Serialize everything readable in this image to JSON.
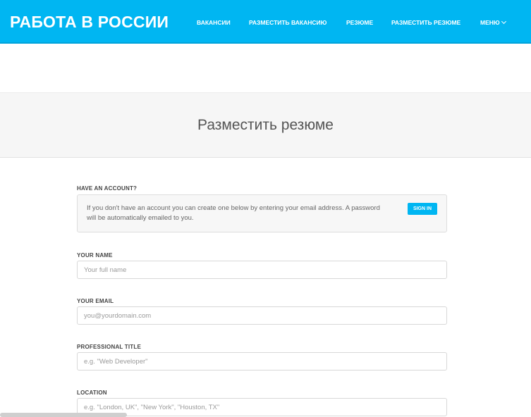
{
  "header": {
    "brand": "РАБОТА В РОССИИ",
    "nav": [
      {
        "label": "ВАКАНСИИ"
      },
      {
        "label": "РАЗМЕСТИТЬ ВАКАНСИЮ"
      },
      {
        "label": "РЕЗЮМЕ"
      },
      {
        "label": "РАЗМЕСТИТЬ РЕЗЮМЕ"
      },
      {
        "label": "МЕНЮ"
      }
    ],
    "accent_color": "#00b6f2"
  },
  "page": {
    "title": "Разместить резюме"
  },
  "form": {
    "account": {
      "label": "HAVE AN ACCOUNT?",
      "text": "If you don't have an account you can create one below by entering your email address. A password will be automatically emailed to you.",
      "signin_label": "SIGN IN"
    },
    "name": {
      "label": "YOUR NAME",
      "placeholder": "Your full name",
      "value": ""
    },
    "email": {
      "label": "YOUR EMAIL",
      "placeholder": "you@yourdomain.com",
      "value": ""
    },
    "professional_title": {
      "label": "PROFESSIONAL TITLE",
      "placeholder": "e.g. \"Web Developer\"",
      "value": ""
    },
    "location": {
      "label": "LOCATION",
      "placeholder": "e.g. \"London, UK\", \"New York\", \"Houston, TX\"",
      "value": ""
    }
  }
}
